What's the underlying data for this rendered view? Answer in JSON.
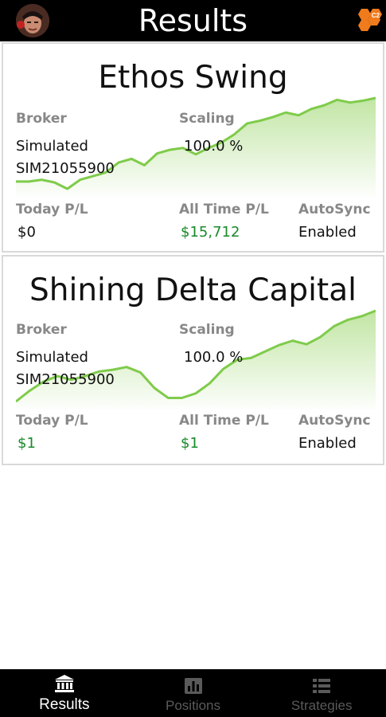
{
  "header": {
    "title": "Results"
  },
  "strategies": [
    {
      "name": "Ethos Swing",
      "broker_label": "Broker",
      "broker_value": "Simulated",
      "account": "SIM21055900",
      "scaling_label": "Scaling",
      "scaling_value": "100.0 %",
      "today_label": "Today P/L",
      "today_value": "$0",
      "alltime_label": "All Time P/L",
      "alltime_value": "$15,712",
      "autosync_label": "AutoSync",
      "autosync_value": "Enabled",
      "sparkline": [
        0.08,
        0.08,
        0.1,
        0.07,
        0.0,
        0.1,
        0.14,
        0.18,
        0.29,
        0.33,
        0.26,
        0.39,
        0.43,
        0.45,
        0.38,
        0.45,
        0.51,
        0.6,
        0.72,
        0.75,
        0.79,
        0.84,
        0.81,
        0.88,
        0.92,
        0.98,
        0.95,
        0.97,
        1.0
      ]
    },
    {
      "name": "Shining Delta Capital",
      "broker_label": "Broker",
      "broker_value": "Simulated",
      "account": "SIM21055900",
      "scaling_label": "Scaling",
      "scaling_value": "100.0 %",
      "today_label": "Today P/L",
      "today_value": "$1",
      "alltime_label": "All Time P/L",
      "alltime_value": "$1",
      "autosync_label": "AutoSync",
      "autosync_value": "Enabled",
      "sparkline": [
        0.0,
        0.12,
        0.22,
        0.28,
        0.24,
        0.28,
        0.33,
        0.35,
        0.38,
        0.32,
        0.15,
        0.04,
        0.04,
        0.09,
        0.2,
        0.36,
        0.46,
        0.48,
        0.55,
        0.62,
        0.67,
        0.63,
        0.71,
        0.83,
        0.9,
        0.94,
        1.0
      ]
    }
  ],
  "tabs": [
    {
      "label": "Results",
      "icon": "bank-icon",
      "active": true
    },
    {
      "label": "Positions",
      "icon": "bar-chart-icon",
      "active": false
    },
    {
      "label": "Strategies",
      "icon": "list-icon",
      "active": false
    }
  ]
}
